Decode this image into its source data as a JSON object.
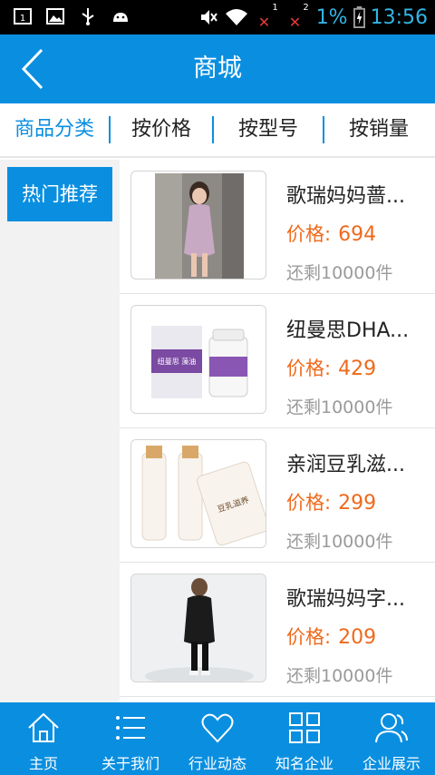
{
  "status_bar": {
    "battery_percent": "1%",
    "time": "13:56",
    "sim1_label": "1",
    "sim2_label": "2",
    "notification_badge": "1"
  },
  "header": {
    "title": "商城"
  },
  "tabs": [
    {
      "label": "商品分类",
      "active": true
    },
    {
      "label": "按价格",
      "active": false
    },
    {
      "label": "按型号",
      "active": false
    },
    {
      "label": "按销量",
      "active": false
    }
  ],
  "sidebar": {
    "items": [
      {
        "label": "热门推荐",
        "active": true
      }
    ]
  },
  "products": [
    {
      "name": "歌瑞妈妈蔷...",
      "price_label": "价格:",
      "price": "694",
      "stock": "还剩10000件"
    },
    {
      "name": "纽曼思DHA...",
      "price_label": "价格:",
      "price": "429",
      "stock": "还剩10000件"
    },
    {
      "name": "亲润豆乳滋...",
      "price_label": "价格:",
      "price": "299",
      "stock": "还剩10000件"
    },
    {
      "name": "歌瑞妈妈字...",
      "price_label": "价格:",
      "price": "209",
      "stock": "还剩10000件"
    }
  ],
  "product_images": {
    "p1_box_text": "纽曼思 藻油",
    "p2_tube_text": "豆乳滋养"
  },
  "bottom_nav": [
    {
      "label": "主页",
      "icon": "home-icon"
    },
    {
      "label": "关于我们",
      "icon": "list-icon"
    },
    {
      "label": "行业动态",
      "icon": "heart-icon"
    },
    {
      "label": "知名企业",
      "icon": "grid-icon"
    },
    {
      "label": "企业展示",
      "icon": "users-icon"
    }
  ],
  "colors": {
    "primary": "#0a8fe0",
    "price": "#ef6a1c",
    "status_accent": "#33b5e5"
  }
}
